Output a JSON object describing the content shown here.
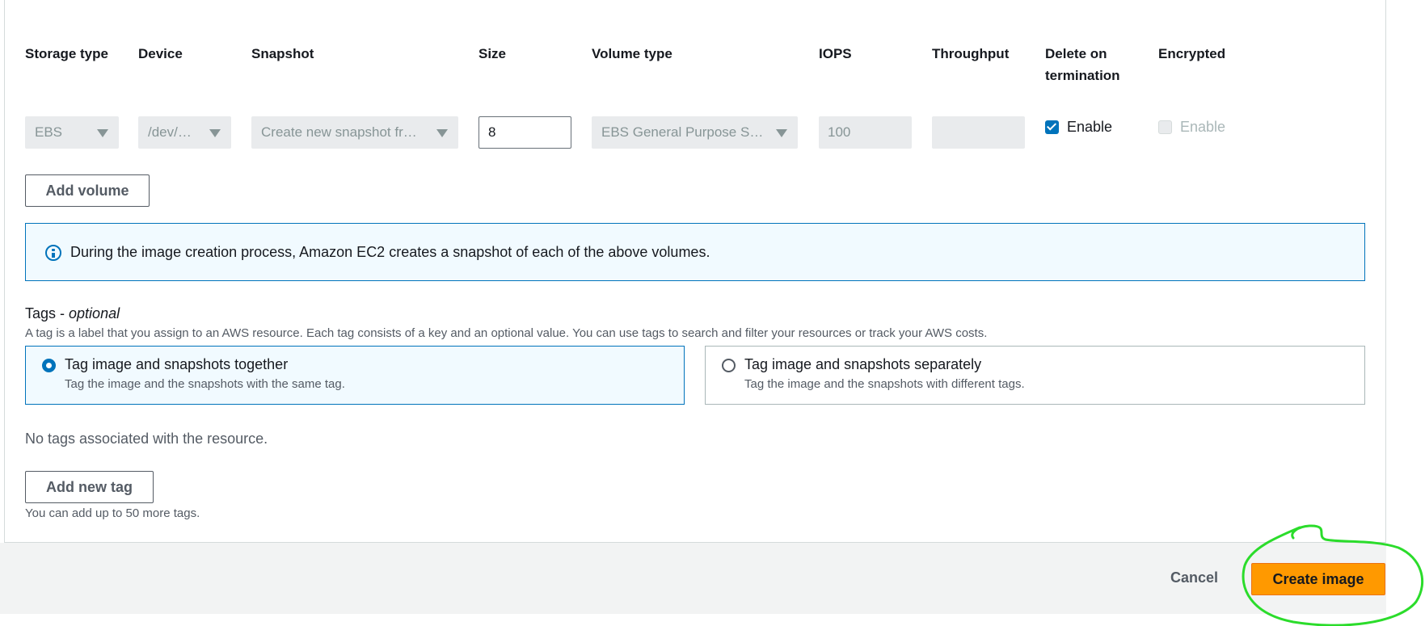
{
  "volumes": {
    "headers": {
      "storage_type": "Storage type",
      "device": "Device",
      "snapshot": "Snapshot",
      "size": "Size",
      "volume_type": "Volume type",
      "iops": "IOPS",
      "throughput": "Throughput",
      "delete_on_termination_line1": "Delete on",
      "delete_on_termination_line2": "termination",
      "encrypted": "Encrypted"
    },
    "row": {
      "storage_type": "EBS",
      "device": "/dev/…",
      "snapshot": "Create new snapshot fr…",
      "size": "8",
      "volume_type": "EBS General Purpose S…",
      "iops": "100",
      "throughput": "",
      "delete_on_termination_label": "Enable",
      "delete_on_termination_checked": true,
      "encrypted_label": "Enable",
      "encrypted_checked": false
    },
    "add_volume_label": "Add volume"
  },
  "info": {
    "text": "During the image creation process, Amazon EC2 creates a snapshot of each of the above volumes."
  },
  "tags": {
    "title": "Tags - ",
    "title_optional": "optional",
    "description": "A tag is a label that you assign to an AWS resource. Each tag consists of a key and an optional value. You can use tags to search and filter your resources or track your AWS costs.",
    "options": [
      {
        "title": "Tag image and snapshots together",
        "description": "Tag the image and the snapshots with the same tag.",
        "selected": true
      },
      {
        "title": "Tag image and snapshots separately",
        "description": "Tag the image and the snapshots with different tags.",
        "selected": false
      }
    ],
    "empty_text": "No tags associated with the resource.",
    "add_tag_label": "Add new tag",
    "limit_hint": "You can add up to 50 more tags."
  },
  "footer": {
    "cancel_label": "Cancel",
    "create_label": "Create image"
  },
  "colors": {
    "primary_button": "#ff9900",
    "info_border": "#0073bb",
    "annotation": "#2bdc2b"
  }
}
